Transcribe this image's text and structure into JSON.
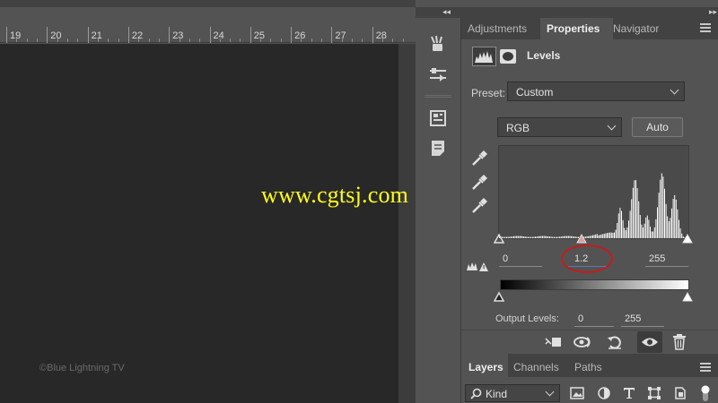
{
  "ruler": {
    "numbers": [
      "19",
      "20",
      "21",
      "22",
      "23",
      "24",
      "25",
      "26",
      "27",
      "28"
    ]
  },
  "canvas": {
    "watermark": "©Blue Lightning TV",
    "site_watermark": "www.cgtsj.com"
  },
  "dock": {
    "collapse_glyph": "◂◂",
    "collapse_glyph_right": "▸▸"
  },
  "panel": {
    "tabs": [
      "Adjustments",
      "Properties",
      "Navigator"
    ],
    "active_tab": "Properties",
    "title": "Levels",
    "preset_label": "Preset:",
    "preset_value": "Custom",
    "channel_value": "RGB",
    "auto_label": "Auto",
    "input_black": "0",
    "input_gamma": "1.2",
    "input_white": "255",
    "output_label": "Output Levels:",
    "output_black": "0",
    "output_white": "255"
  },
  "layers": {
    "tabs": [
      "Layers",
      "Channels",
      "Paths"
    ],
    "active_tab": "Layers",
    "filter_kind": "Kind"
  },
  "icons": {
    "iconbar": [
      "brush-tools-icon",
      "adjustments-sliders-icon",
      "properties-panel-icon",
      "notes-panel-icon"
    ],
    "bottom_toolbar": [
      "clip-to-layer-icon",
      "view-previous-state-icon",
      "reset-icon",
      "toggle-visibility-icon",
      "delete-icon"
    ],
    "layer_filters": [
      "pixel-filter-icon",
      "adjustment-filter-icon",
      "type-filter-icon",
      "shape-filter-icon",
      "smart-object-filter-icon",
      "filter-toggle-icon"
    ]
  },
  "colors": {
    "annotation": "#c41c1c",
    "site_watermark": "#ffff1a",
    "panel_bg": "#535353",
    "canvas_bg": "#282828"
  }
}
